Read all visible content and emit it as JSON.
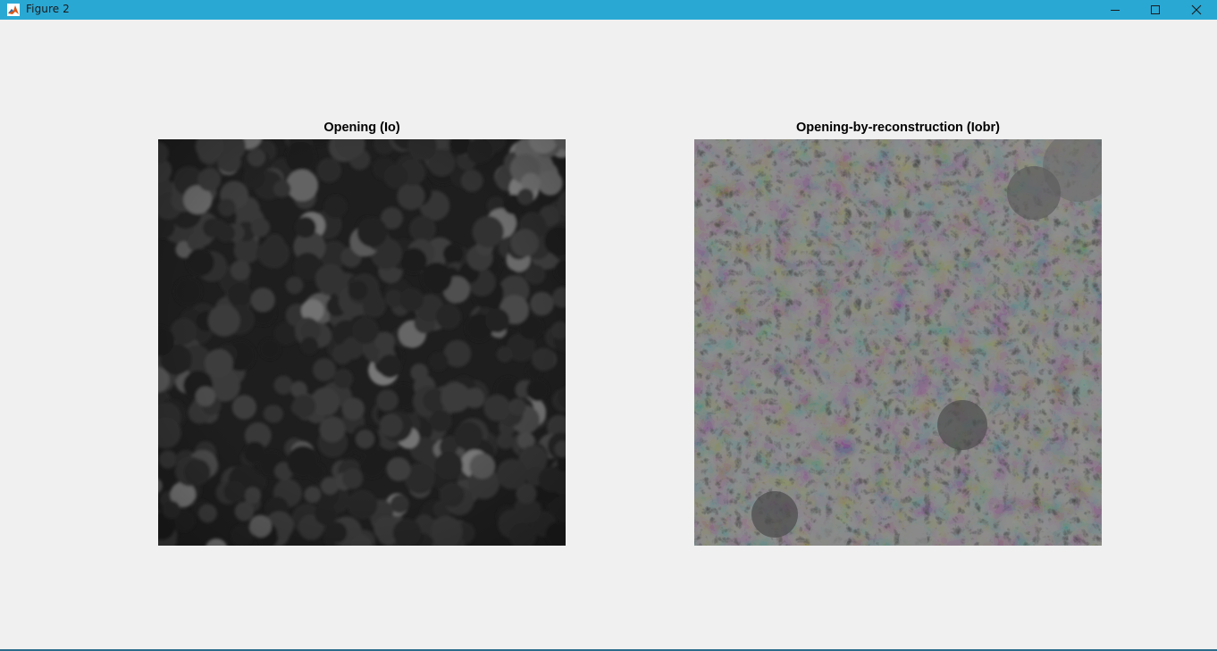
{
  "window": {
    "title": "Figure 2",
    "titlebar_color": "#2aa8d4",
    "icons": [
      "matlab-icon",
      "minimize-icon",
      "maximize-icon",
      "close-icon"
    ]
  },
  "figure": {
    "background": "#f0f0f0",
    "axes": [
      {
        "title": "Opening (Io)",
        "content": "grayscale-image",
        "tone": "dark-blobs"
      },
      {
        "title": "Opening-by-reconstruction (Iobr)",
        "content": "grayscale-image",
        "tone": "reconstructed-regions"
      }
    ]
  }
}
